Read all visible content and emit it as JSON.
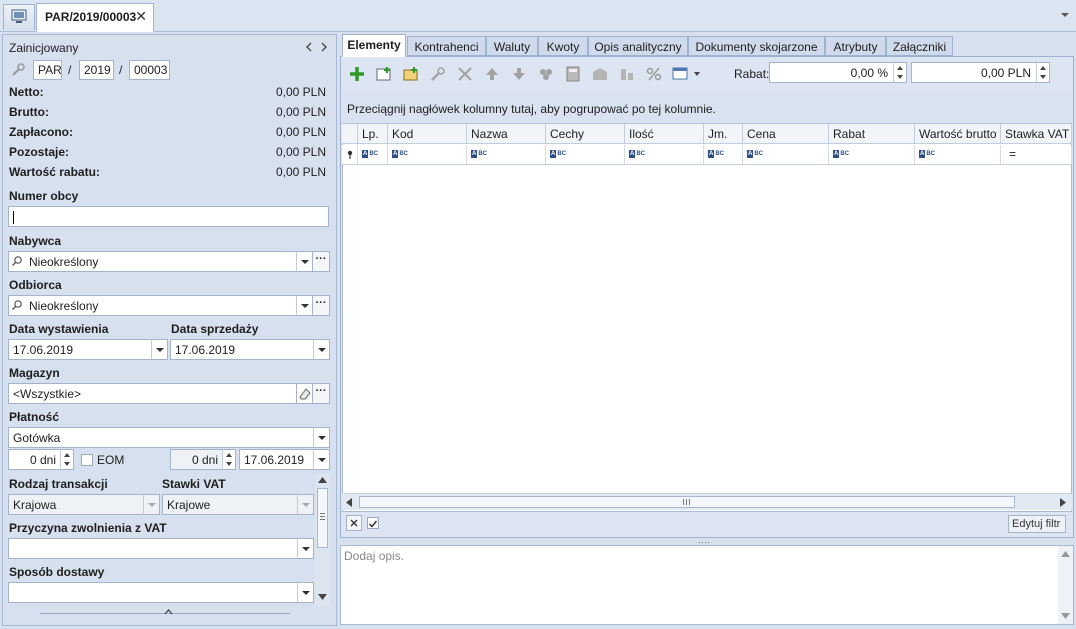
{
  "window": {
    "doc_tab_title": "PAR/2019/00003",
    "close_glyph": "✕"
  },
  "left": {
    "status": "Zainicjowany",
    "number": {
      "prefix": "PAR",
      "year": "2019",
      "seq": "00003",
      "sep": "/"
    },
    "summary": [
      {
        "label": "Netto:",
        "value": "0,00 PLN"
      },
      {
        "label": "Brutto:",
        "value": "0,00 PLN"
      },
      {
        "label": "Zapłacono:",
        "value": "0,00 PLN"
      },
      {
        "label": "Pozostaje:",
        "value": "0,00 PLN"
      },
      {
        "label": "Wartość rabatu:",
        "value": "0,00 PLN"
      }
    ],
    "numer_obcy_label": "Numer obcy",
    "numer_obcy_value": "",
    "nabywca_label": "Nabywca",
    "nabywca_value": "Nieokreślony",
    "odbiorca_label": "Odbiorca",
    "odbiorca_value": "Nieokreślony",
    "data_wystawienia_label": "Data wystawienia",
    "data_wystawienia_value": "17.06.2019",
    "data_sprzedazy_label": "Data sprzedaży",
    "data_sprzedazy_value": "17.06.2019",
    "magazyn_label": "Magazyn",
    "magazyn_value": "<Wszystkie>",
    "platnosc_label": "Płatność",
    "platnosc_value": "Gotówka",
    "termin_days": "0 dni",
    "eom_label": "EOM",
    "termin_days2": "0 dni",
    "termin_date": "17.06.2019",
    "rodzaj_label": "Rodzaj transakcji",
    "rodzaj_value": "Krajowa",
    "stawki_label": "Stawki VAT",
    "stawki_value": "Krajowe",
    "przyczyna_label": "Przyczyna zwolnienia z VAT",
    "przyczyna_value": "",
    "sposob_label": "Sposób dostawy",
    "sposob_value": "",
    "dots": "···"
  },
  "right": {
    "tabs": [
      {
        "label": "Elementy",
        "active": true
      },
      {
        "label": "Kontrahenci"
      },
      {
        "label": "Waluty"
      },
      {
        "label": "Kwoty"
      },
      {
        "label": "Opis analityczny"
      },
      {
        "label": "Dokumenty skojarzone"
      },
      {
        "label": "Atrybuty"
      },
      {
        "label": "Załączniki"
      }
    ],
    "rabat_label": "Rabat:",
    "rabat_percent": "0,00 %",
    "rabat_amount": "0,00 PLN",
    "group_hint": "Przeciągnij nagłówek kolumny tutaj, aby pogrupować po tej kolumnie.",
    "columns": [
      "Lp.",
      "Kod",
      "Nazwa",
      "Cechy",
      "Ilość",
      "Jm.",
      "Cena",
      "Rabat",
      "Wartość brutto",
      "Stawka VAT"
    ],
    "abc_text": "BC",
    "abc_a": "A",
    "stawka_filter_op": "=",
    "edit_filter_label": "Edytuj filtr",
    "description_placeholder": "Dodaj opis.",
    "splitter_dots": "····"
  }
}
